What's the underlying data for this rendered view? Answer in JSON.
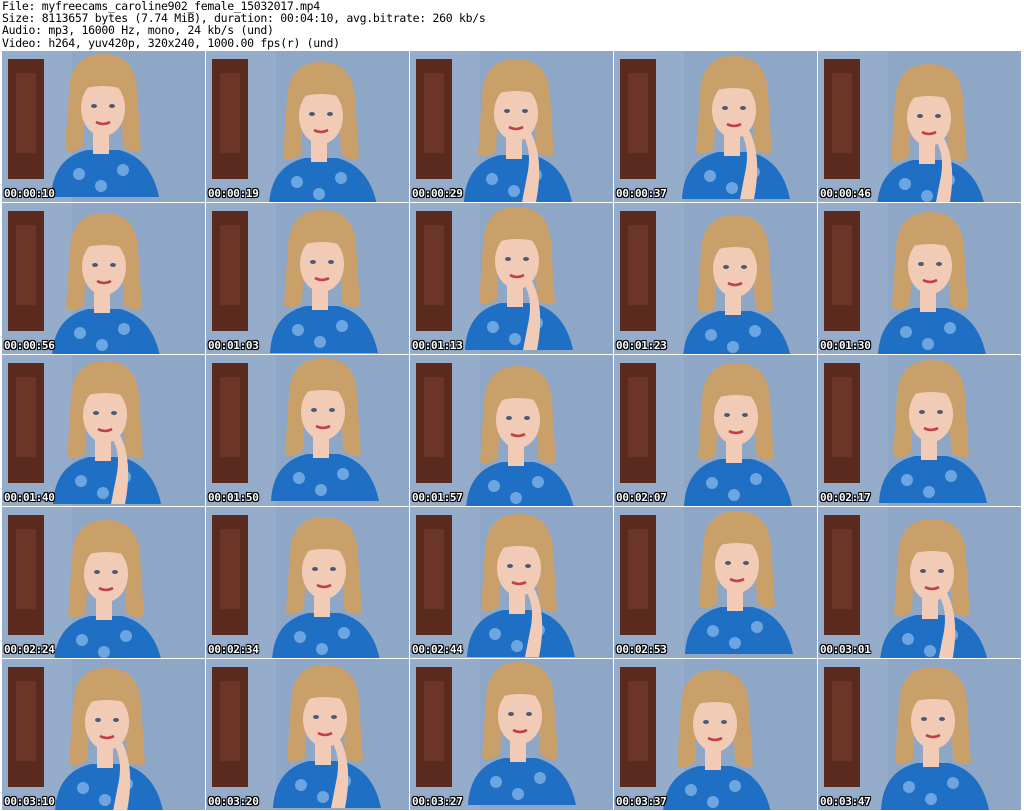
{
  "header": {
    "file_line": "File: myfreecams_caroline902_female_15032017.mp4",
    "size_line": "Size: 8113657 bytes (7.74 MiB), duration: 00:04:10, avg.bitrate: 260 kb/s",
    "audio_line": "Audio: mp3, 16000 Hz, mono, 24 kb/s (und)",
    "video_line": "Video: h264, yuv420p, 320x240, 1000.00 fps(r) (und)"
  },
  "thumbnails": [
    {
      "timestamp": "00:00:10"
    },
    {
      "timestamp": "00:00:19"
    },
    {
      "timestamp": "00:00:29"
    },
    {
      "timestamp": "00:00:37"
    },
    {
      "timestamp": "00:00:46"
    },
    {
      "timestamp": "00:00:56"
    },
    {
      "timestamp": "00:01:03"
    },
    {
      "timestamp": "00:01:13"
    },
    {
      "timestamp": "00:01:23"
    },
    {
      "timestamp": "00:01:30"
    },
    {
      "timestamp": "00:01:40"
    },
    {
      "timestamp": "00:01:50"
    },
    {
      "timestamp": "00:01:57"
    },
    {
      "timestamp": "00:02:07"
    },
    {
      "timestamp": "00:02:17"
    },
    {
      "timestamp": "00:02:24"
    },
    {
      "timestamp": "00:02:34"
    },
    {
      "timestamp": "00:02:44"
    },
    {
      "timestamp": "00:02:53"
    },
    {
      "timestamp": "00:03:01"
    },
    {
      "timestamp": "00:03:10"
    },
    {
      "timestamp": "00:03:20"
    },
    {
      "timestamp": "00:03:27"
    },
    {
      "timestamp": "00:03:37"
    },
    {
      "timestamp": "00:03:47"
    }
  ],
  "colors": {
    "wall": "#8ea7c6",
    "door": "#5a2a1e",
    "hair": "#c9a06a",
    "skin": "#f1cbb6",
    "shirt": "#1f6fc4",
    "timestamp_text": "#ffffff"
  }
}
